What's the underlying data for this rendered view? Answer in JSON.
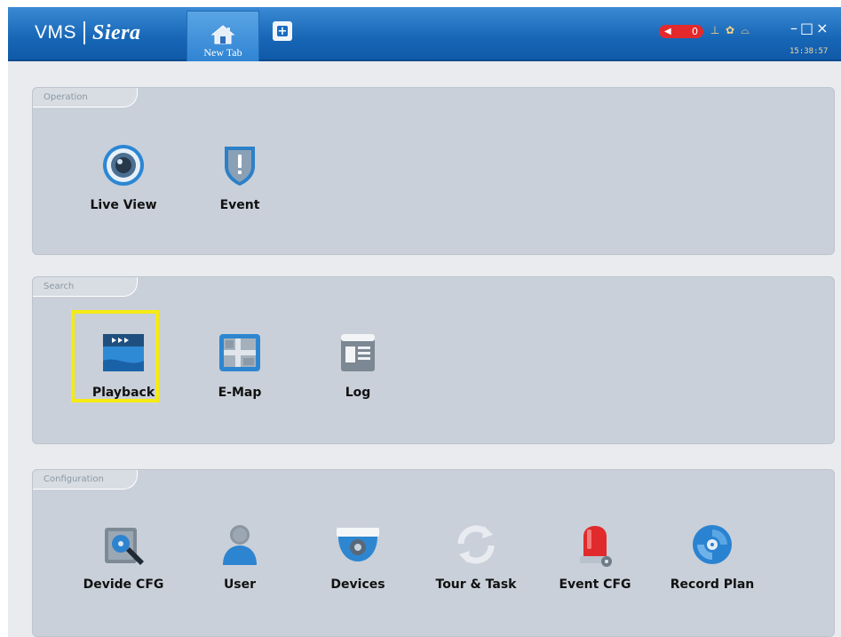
{
  "app": {
    "brand_left": "VMS",
    "brand_right": "Siera"
  },
  "tabs": [
    {
      "label": "New Tab",
      "icon": "home-icon",
      "active": true
    }
  ],
  "header": {
    "alarm_count": "0",
    "clock": "15:38:57"
  },
  "sections": [
    {
      "title": "Operation",
      "items": [
        {
          "label": "Live View",
          "icon": "camera-lens-icon"
        },
        {
          "label": "Event",
          "icon": "shield-alert-icon"
        }
      ]
    },
    {
      "title": "Search",
      "items": [
        {
          "label": "Playback",
          "icon": "playback-clapper-icon",
          "highlighted": true
        },
        {
          "label": "E-Map",
          "icon": "map-icon"
        },
        {
          "label": "Log",
          "icon": "log-document-icon"
        }
      ]
    },
    {
      "title": "Configuration",
      "items": [
        {
          "label": "Devide CFG",
          "icon": "device-config-icon"
        },
        {
          "label": "User",
          "icon": "user-icon"
        },
        {
          "label": "Devices",
          "icon": "dome-camera-icon"
        },
        {
          "label": "Tour & Task",
          "icon": "refresh-cycle-icon"
        },
        {
          "label": "Event CFG",
          "icon": "alarm-siren-icon"
        },
        {
          "label": "Record Plan",
          "icon": "record-disc-icon"
        }
      ]
    }
  ],
  "colors": {
    "titlebar": "#1766b6",
    "panel": "#c9d0d9",
    "highlight": "#f5ea14",
    "alarm": "#e4292c"
  }
}
